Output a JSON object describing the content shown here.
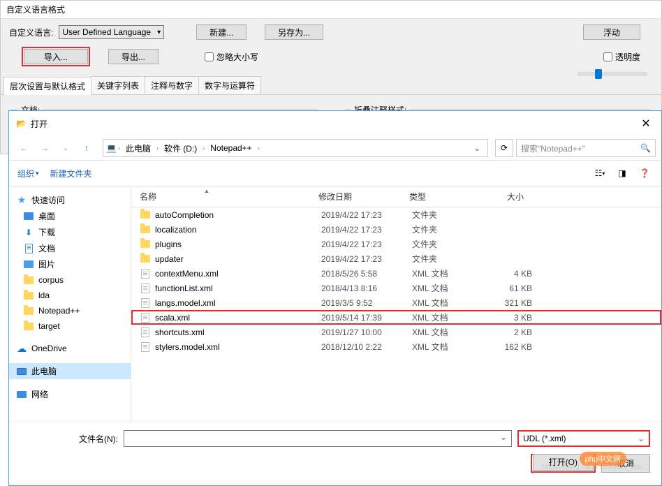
{
  "top_dialog": {
    "title": "自定义语言格式",
    "lang_label": "自定义语言:",
    "lang_value": "User Defined Language",
    "new_btn": "新建...",
    "saveas_btn": "另存为...",
    "float_btn": "浮动",
    "import_btn": "导入...",
    "export_btn": "导出...",
    "ignore_case": "忽略大小写",
    "transparency": "透明度",
    "tabs": [
      "层次设置与默认格式",
      "关键字列表",
      "注释与数字",
      "数字与运算符"
    ],
    "fieldset1": "文档:",
    "fieldset2": "折叠注释样式:"
  },
  "open_dialog": {
    "title": "打开",
    "breadcrumb": [
      "此电脑",
      "软件 (D:)",
      "Notepad++"
    ],
    "search_placeholder": "搜索\"Notepad++\"",
    "organize": "组织",
    "new_folder": "新建文件夹",
    "columns": {
      "name": "名称",
      "date": "修改日期",
      "type": "类型",
      "size": "大小"
    },
    "sidebar": {
      "quick_access": "快速访问",
      "desktop": "桌面",
      "downloads": "下载",
      "documents": "文档",
      "pictures": "图片",
      "folders": [
        "corpus",
        "lda",
        "Notepad++",
        "target"
      ],
      "onedrive": "OneDrive",
      "this_pc": "此电脑",
      "network": "网络"
    },
    "files": [
      {
        "name": "autoCompletion",
        "date": "2019/4/22 17:23",
        "type": "文件夹",
        "size": "",
        "icon": "folder"
      },
      {
        "name": "localization",
        "date": "2019/4/22 17:23",
        "type": "文件夹",
        "size": "",
        "icon": "folder"
      },
      {
        "name": "plugins",
        "date": "2019/4/22 17:23",
        "type": "文件夹",
        "size": "",
        "icon": "folder"
      },
      {
        "name": "updater",
        "date": "2019/4/22 17:23",
        "type": "文件夹",
        "size": "",
        "icon": "folder"
      },
      {
        "name": "contextMenu.xml",
        "date": "2018/5/26 5:58",
        "type": "XML 文档",
        "size": "4 KB",
        "icon": "xml"
      },
      {
        "name": "functionList.xml",
        "date": "2018/4/13 8:16",
        "type": "XML 文档",
        "size": "61 KB",
        "icon": "xml"
      },
      {
        "name": "langs.model.xml",
        "date": "2019/3/5 9:52",
        "type": "XML 文档",
        "size": "321 KB",
        "icon": "xml"
      },
      {
        "name": "scala.xml",
        "date": "2019/5/14 17:39",
        "type": "XML 文档",
        "size": "3 KB",
        "icon": "xml",
        "highlighted": true
      },
      {
        "name": "shortcuts.xml",
        "date": "2019/1/27 10:00",
        "type": "XML 文档",
        "size": "2 KB",
        "icon": "xml"
      },
      {
        "name": "stylers.model.xml",
        "date": "2018/12/10 2:22",
        "type": "XML 文档",
        "size": "162 KB",
        "icon": "xml"
      }
    ],
    "filename_label": "文件名(N):",
    "filetype_value": "UDL (*.xml)",
    "open_btn": "打开(O)",
    "cancel_btn": "取消"
  },
  "watermark": "https://blog.csdn.net/ywh_zte...",
  "php_badge": "php中文网"
}
